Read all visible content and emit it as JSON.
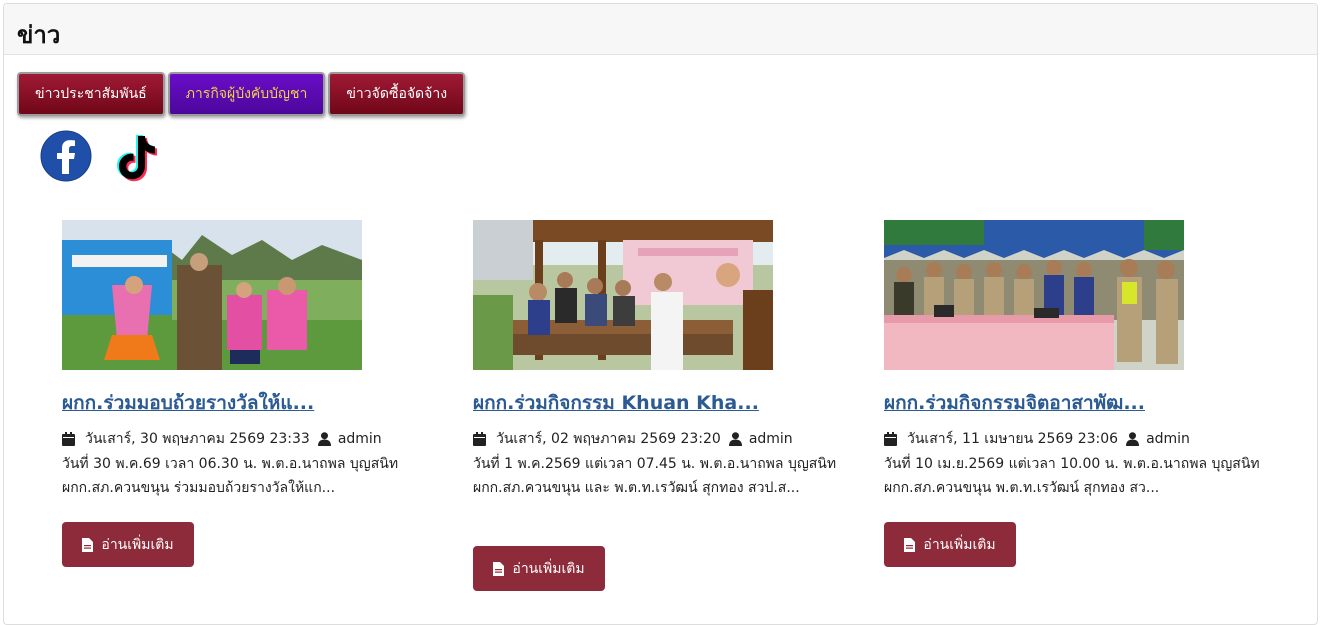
{
  "header": {
    "title": "ข่าว"
  },
  "tabs": [
    {
      "label": "ข่าวประชาสัมพันธ์"
    },
    {
      "label": "ภารกิจผู้บังคับบัญชา"
    },
    {
      "label": "ข่าวจัดซื้อจัดจ้าง"
    }
  ],
  "social": {
    "facebook_icon": "facebook-icon",
    "tiktok_icon": "tiktok-icon"
  },
  "colors": {
    "tab_red": "#8a0f25",
    "tab_purple": "#5a0ab5",
    "title_link": "#2c5a93",
    "button": "#8e2b3b"
  },
  "news": [
    {
      "title": "ผกก.ร่วมมอบถ้วยรางวัลให้แ...",
      "date": "วันเสาร์, 30 พฤษภาคม 2569 23:33",
      "author": "admin",
      "excerpt": "วันที่ 30 พ.ค.69 เวลา 06.30 น.   พ.ต.อ.นาถพล บุญสนิท ผกก.สภ.ควนขนุน ร่วมมอบถ้วยรางวัลให้แก...",
      "button": "อ่านเพิ่มเติม"
    },
    {
      "title": "ผกก.ร่วมกิจกรรม Khuan Kha...",
      "date": "วันเสาร์, 02 พฤษภาคม 2569 23:20",
      "author": "admin",
      "excerpt": "วันที่ 1 พ.ค.2569 แต่เวลา 07.45 น. พ.ต.อ.นาถพล บุญสนิท ผกก.สภ.ควนขนุน และ พ.ต.ท.เรวัฒน์ สุกทอง สวป.ส...",
      "button": "อ่านเพิ่มเติม"
    },
    {
      "title": "ผกก.ร่วมกิจกรรมจิตอาสาพัฒ...",
      "date": "วันเสาร์, 11 เมษายน 2569 23:06",
      "author": "admin",
      "excerpt": "วันที่ 10 เม.ย.2569 แต่เวลา 10.00 น.  พ.ต.อ.นาถพล บุญสนิทผกก.สภ.ควนขนุน พ.ต.ท.เรวัฒน์ สุกทอง สว...",
      "button": "อ่านเพิ่มเติม"
    }
  ]
}
